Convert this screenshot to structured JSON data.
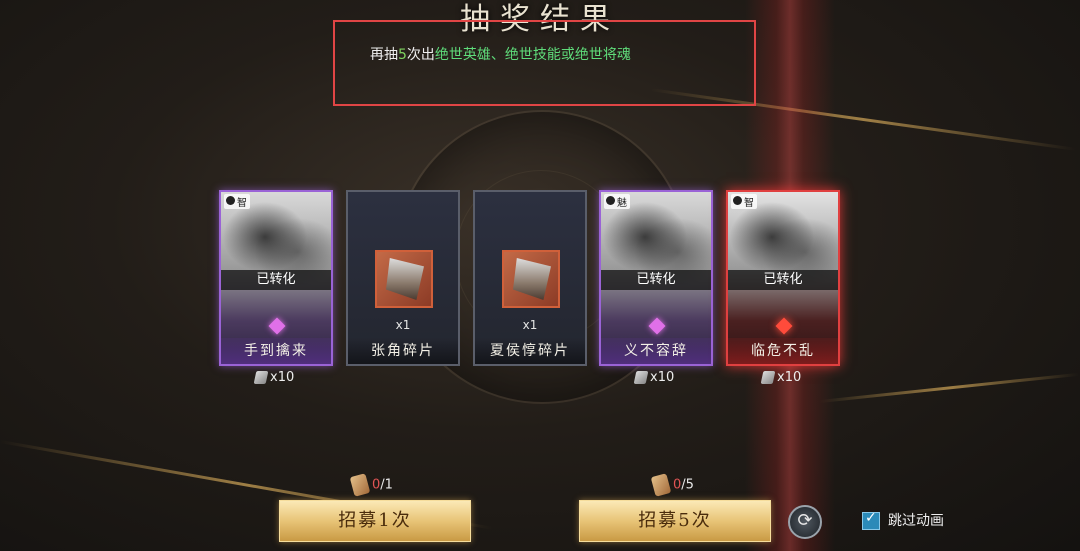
{
  "title": "抽奖结果",
  "notice": {
    "prefix": "再抽",
    "count": "5",
    "mid": "次出",
    "highlight": "绝世英雄、绝世技能或绝世将魂"
  },
  "cards": [
    {
      "attr": "智",
      "status": "已转化",
      "name": "手到擒来",
      "reward": "x10",
      "rarity": "purple"
    },
    {
      "name": "张角碎片",
      "qty": "x1",
      "rarity": "shard"
    },
    {
      "name": "夏侯惇碎片",
      "qty": "x1",
      "rarity": "shard"
    },
    {
      "attr": "魅",
      "status": "已转化",
      "name": "义不容辞",
      "reward": "x10",
      "rarity": "purple"
    },
    {
      "attr": "智",
      "status": "已转化",
      "name": "临危不乱",
      "reward": "x10",
      "rarity": "red"
    }
  ],
  "recruit_one": {
    "label": "招募1次",
    "current": "0",
    "total": "/1"
  },
  "recruit_five": {
    "label": "招募5次",
    "current": "0",
    "total": "/5"
  },
  "skip_animation": {
    "label": "跳过动画",
    "checked": true
  },
  "colors": {
    "accent_gold": "#e8c477",
    "purple": "#9a63d6",
    "red": "#e04040",
    "notice_border": "#e04545"
  }
}
